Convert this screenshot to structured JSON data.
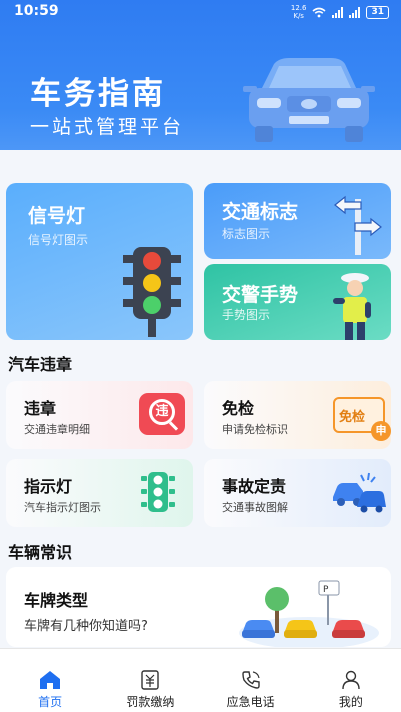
{
  "status": {
    "time": "10:59",
    "speed_value": "12.6",
    "speed_unit": "K/s",
    "battery": "31"
  },
  "hero": {
    "title": "车务指南",
    "subtitle": "一站式管理平台"
  },
  "cards": {
    "signal": {
      "title": "信号灯",
      "subtitle": "信号灯图示"
    },
    "sign": {
      "title": "交通标志",
      "subtitle": "标志图示"
    },
    "police": {
      "title": "交警手势",
      "subtitle": "手势图示"
    }
  },
  "violations": {
    "section_title": "汽车违章",
    "items": [
      {
        "title": "违章",
        "subtitle": "交通违章明细",
        "icon_text": "违"
      },
      {
        "title": "免检",
        "subtitle": "申请免检标识",
        "icon_text": "免检",
        "icon_badge": "申"
      },
      {
        "title": "指示灯",
        "subtitle": "汽车指示灯图示"
      },
      {
        "title": "事故定责",
        "subtitle": "交通事故图解"
      }
    ]
  },
  "knowledge": {
    "section_title": "车辆常识",
    "plate_card": {
      "title": "车牌类型",
      "subtitle": "车牌有几种你知道吗?",
      "sign_text": "P"
    }
  },
  "tabbar": {
    "items": [
      {
        "label": "首页",
        "icon": "home-icon"
      },
      {
        "label": "罚款缴纳",
        "icon": "yuan-ticket-icon"
      },
      {
        "label": "应急电话",
        "icon": "phone-icon"
      },
      {
        "label": "我的",
        "icon": "user-icon"
      }
    ],
    "active_color": "#1f6ff0"
  },
  "colors": {
    "primary": "#2f7cf2",
    "background": "#f3f6fb"
  }
}
